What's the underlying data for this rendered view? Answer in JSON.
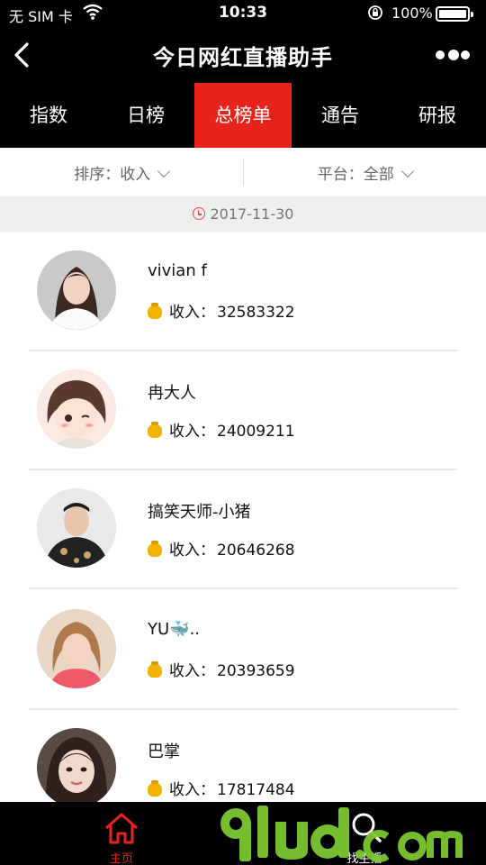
{
  "status_bar": {
    "carrier": "无 SIM 卡",
    "time": "10:33",
    "battery": "100%",
    "battery_level": 1.0
  },
  "nav": {
    "title": "今日网红直播助手",
    "back_icon": "chevron-left-icon",
    "more_icon": "more-dots-icon"
  },
  "tabs": [
    {
      "label": "指数",
      "active": false
    },
    {
      "label": "日榜",
      "active": false
    },
    {
      "label": "总榜单",
      "active": true
    },
    {
      "label": "通告",
      "active": false
    },
    {
      "label": "研报",
      "active": false
    }
  ],
  "filters": {
    "sort": "排序：收入",
    "platform": "平台：全部"
  },
  "date": "2017-11-30",
  "income_label": "收入：",
  "streamers": [
    {
      "name": "vivian f",
      "income": "32583322"
    },
    {
      "name": "冉大人",
      "income": "24009211"
    },
    {
      "name": "搞笑天师-小猪",
      "income": "20646268"
    },
    {
      "name": "YU🐳..",
      "income": "20393659"
    },
    {
      "name": "巴掌",
      "income": "17817484"
    }
  ],
  "bottom_tabs": {
    "home": "主页",
    "find": "找主播"
  },
  "watermark": {
    "logo": "9lud.com",
    "small": "小程序商店"
  },
  "colors": {
    "accent": "#e8231c",
    "coin": "#f0b400",
    "watermark": "#7cc832"
  }
}
